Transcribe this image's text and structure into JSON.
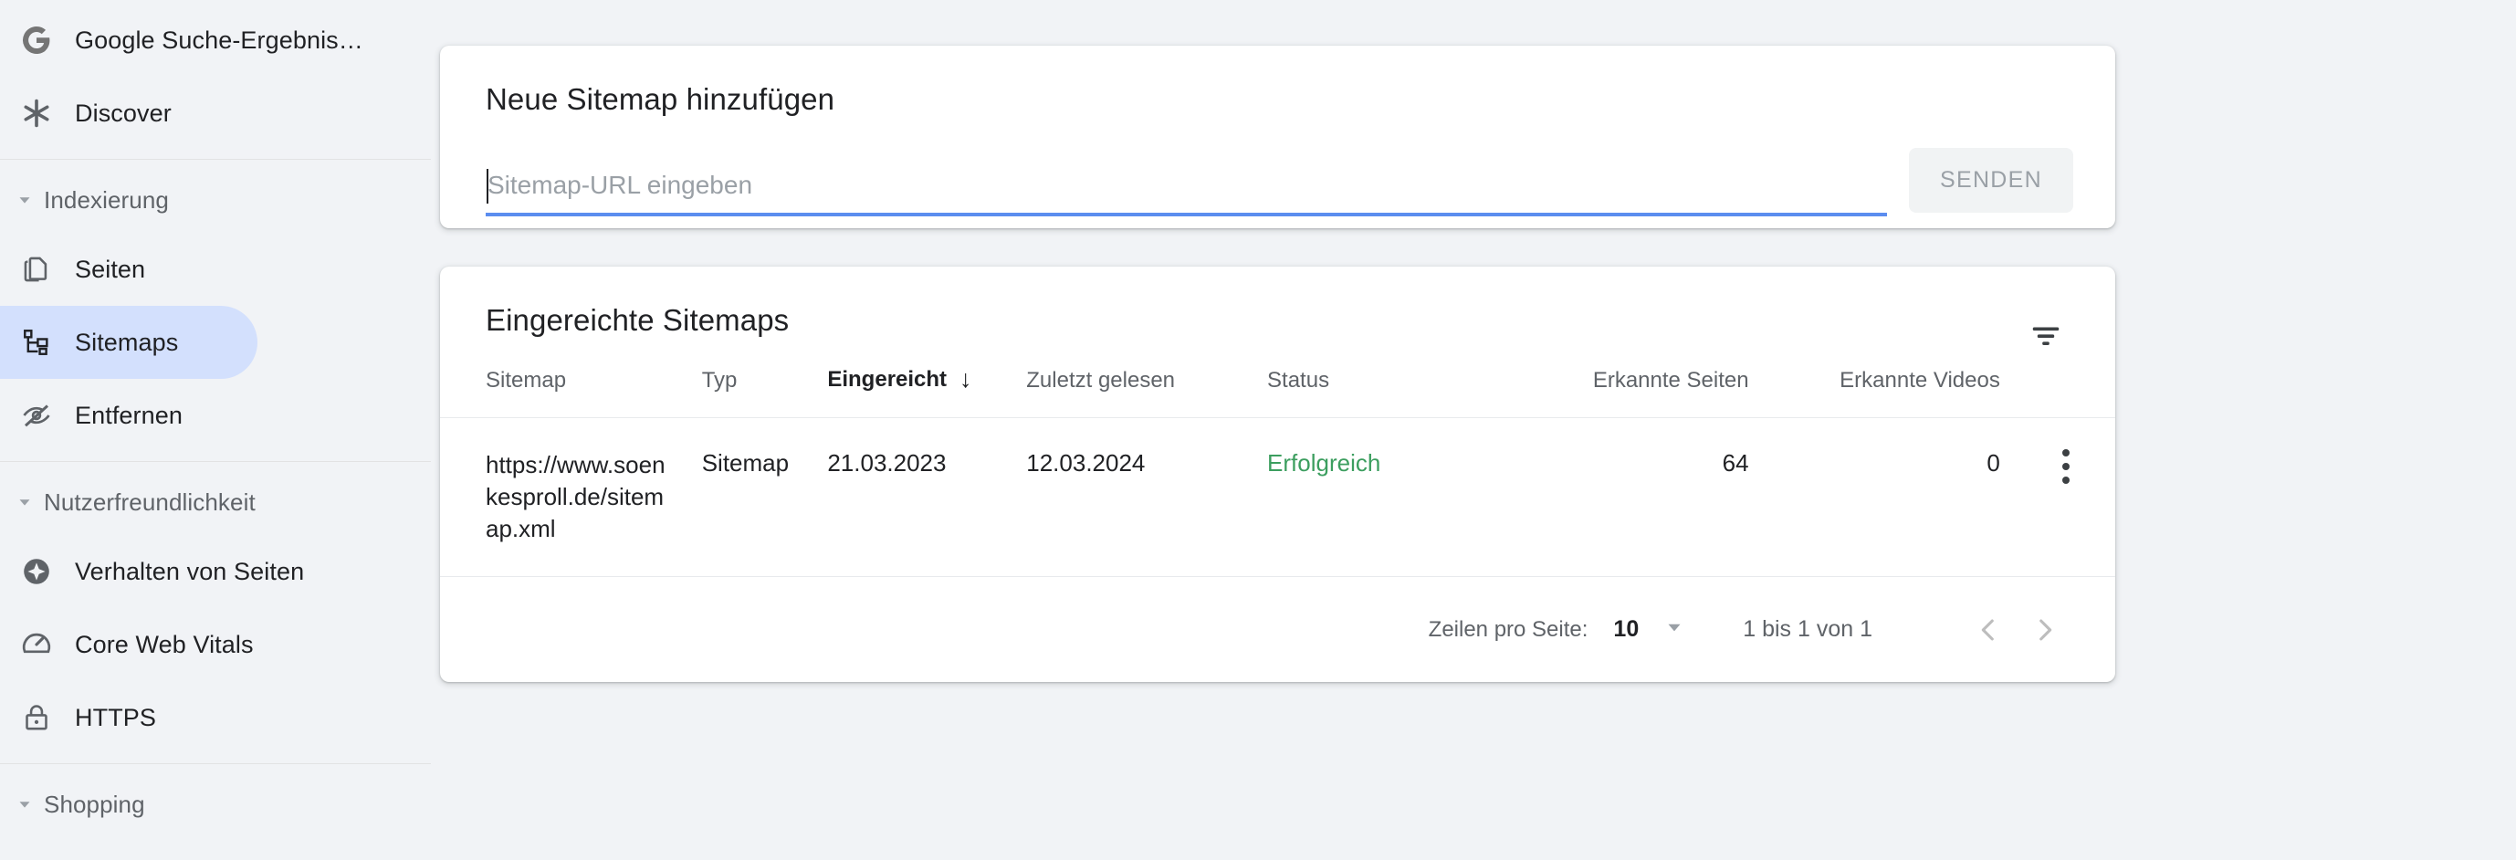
{
  "sidebar": {
    "top_items": [
      {
        "label": "Google Suche-Ergebnis…",
        "icon": "google-g-icon"
      },
      {
        "label": "Discover",
        "icon": "asterisk-icon"
      }
    ],
    "sections": [
      {
        "title": "Indexierung",
        "items": [
          {
            "label": "Seiten",
            "icon": "pages-icon",
            "selected": false
          },
          {
            "label": "Sitemaps",
            "icon": "sitemap-icon",
            "selected": true
          },
          {
            "label": "Entfernen",
            "icon": "eye-off-icon",
            "selected": false
          }
        ]
      },
      {
        "title": "Nutzerfreundlichkeit",
        "items": [
          {
            "label": "Verhalten von Seiten",
            "icon": "page-experience-icon",
            "selected": false
          },
          {
            "label": "Core Web Vitals",
            "icon": "speedometer-icon",
            "selected": false
          },
          {
            "label": "HTTPS",
            "icon": "lock-icon",
            "selected": false
          }
        ]
      },
      {
        "title": "Shopping",
        "items": []
      }
    ]
  },
  "add_sitemap": {
    "title": "Neue Sitemap hinzufügen",
    "input_placeholder": "Sitemap-URL eingeben",
    "input_value": "",
    "submit_label": "SENDEN",
    "submit_disabled": true,
    "focus_underline_color": "#5b8def"
  },
  "submitted_sitemaps": {
    "title": "Eingereichte Sitemaps",
    "filter_icon": "filter-icon",
    "columns": [
      {
        "label": "Sitemap",
        "sorted": false,
        "numeric": false
      },
      {
        "label": "Typ",
        "sorted": false,
        "numeric": false
      },
      {
        "label": "Eingereicht",
        "sorted": true,
        "sort_dir": "↓",
        "numeric": false
      },
      {
        "label": "Zuletzt gelesen",
        "sorted": false,
        "numeric": false
      },
      {
        "label": "Status",
        "sorted": false,
        "numeric": false
      },
      {
        "label": "Erkannte Seiten",
        "sorted": false,
        "numeric": true
      },
      {
        "label": "Erkannte Videos",
        "sorted": false,
        "numeric": true
      }
    ],
    "rows": [
      {
        "sitemap": "https://www.soenkesproll.de/sitemap.xml",
        "typ": "Sitemap",
        "eingereicht": "21.03.2023",
        "zuletzt_gelesen": "12.03.2024",
        "status": "Erfolgreich",
        "status_color": "#3c9e5f",
        "erkannte_seiten": "64",
        "erkannte_videos": "0",
        "menu_icon": "kebab-menu-icon"
      }
    ],
    "pagination": {
      "rows_per_page_label": "Zeilen pro Seite:",
      "rows_per_page_value": "10",
      "range_label": "1 bis 1 von 1",
      "prev_icon": "chevron-left-icon",
      "next_icon": "chevron-right-icon",
      "prev_disabled": true,
      "next_disabled": true
    }
  }
}
